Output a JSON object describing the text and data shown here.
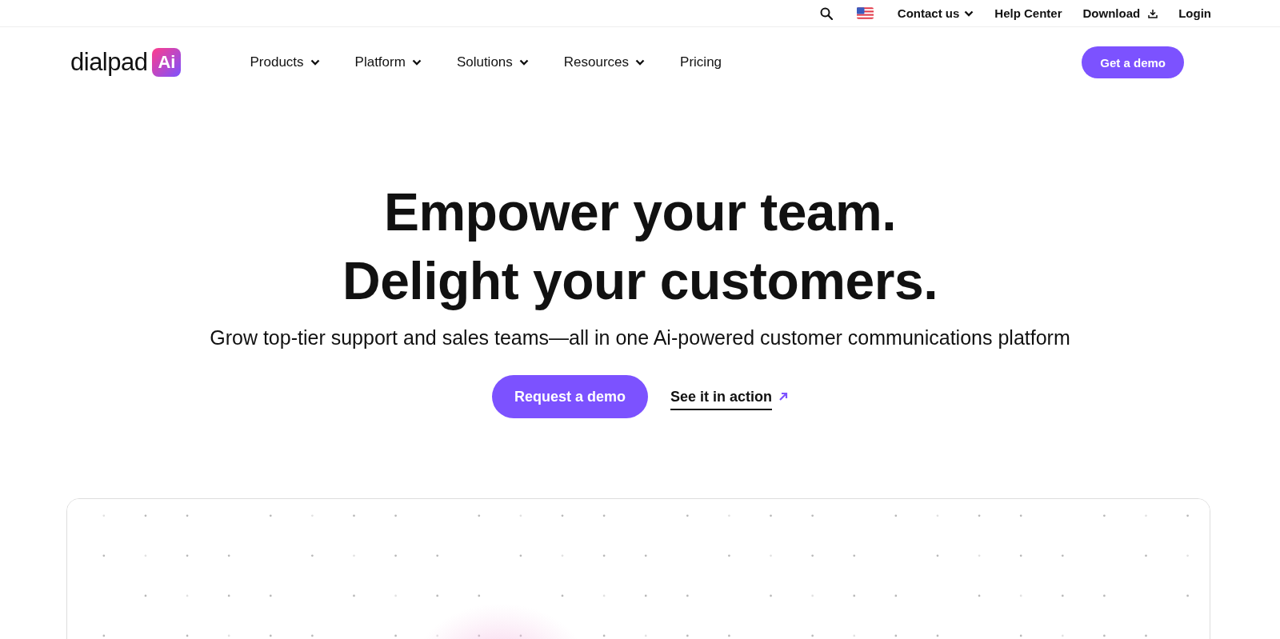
{
  "utility_bar": {
    "links": [
      {
        "label": "Contact us",
        "kind": "dropdown"
      },
      {
        "label": "Help Center",
        "kind": "plain"
      },
      {
        "label": "Download",
        "kind": "download"
      },
      {
        "label": "Login",
        "kind": "plain"
      }
    ]
  },
  "header": {
    "logo": {
      "wordmark": "dialpad",
      "badge": "Ai"
    },
    "nav": [
      {
        "label": "Products",
        "kind": "dropdown"
      },
      {
        "label": "Platform",
        "kind": "dropdown"
      },
      {
        "label": "Solutions",
        "kind": "dropdown"
      },
      {
        "label": "Resources",
        "kind": "dropdown"
      },
      {
        "label": "Pricing",
        "kind": "plain"
      }
    ],
    "cta": "Get a demo"
  },
  "hero": {
    "title_lines": [
      "Empower your team.",
      "Delight your customers."
    ],
    "subtitle": "Grow top-tier support and sales teams—all in one Ai-powered customer communications platform",
    "primary_button": "Request a demo",
    "secondary_link": "See it in action"
  }
}
